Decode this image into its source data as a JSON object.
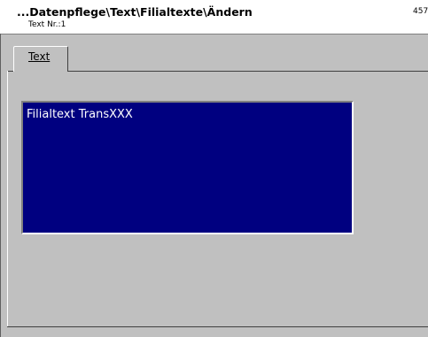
{
  "window": {
    "title": "...Datenpflege\\Text\\Filialtexte\\Ändern",
    "subtitle": "Text Nr.:1",
    "number": "457"
  },
  "tabs": [
    {
      "label": "Text",
      "active": true
    }
  ],
  "textbox": {
    "value": "Filialtext TransXXX",
    "background_color": "#000080",
    "text_color": "#ffffff"
  },
  "colors": {
    "window_bg": "#c0c0c0",
    "titlebar_bg": "#ffffff"
  }
}
